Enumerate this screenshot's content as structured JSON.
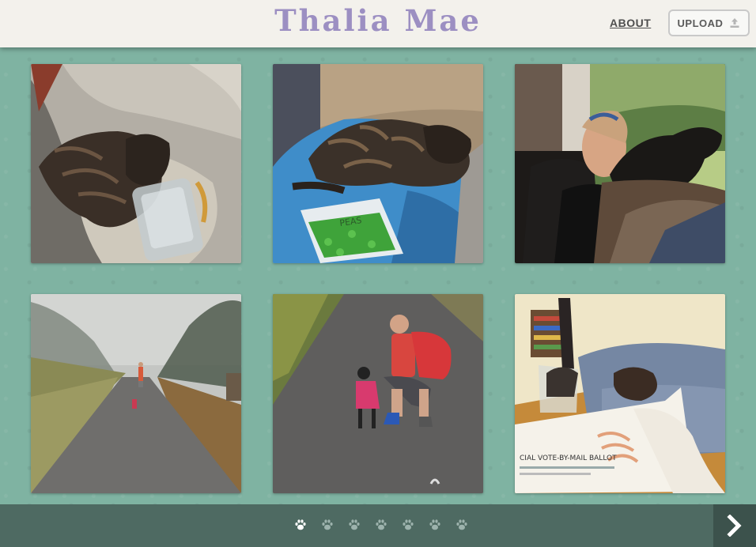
{
  "header": {
    "title": "Thalia Mae",
    "about_label": "ABOUT",
    "upload_label": "UPLOAD",
    "upload_icon": "upload-icon"
  },
  "gallery": {
    "photos": [
      {
        "name": "photo-dog-in-car-seat"
      },
      {
        "name": "photo-dog-on-blanket-with-peas"
      },
      {
        "name": "photo-woman-with-dog"
      },
      {
        "name": "photo-foggy-road-walk"
      },
      {
        "name": "photo-man-with-dog-on-road"
      },
      {
        "name": "photo-dog-on-couch-with-ballot"
      }
    ],
    "ballot_text": "CIAL VOTE-BY-MAIL BALLOT",
    "peas_label": "PEAS"
  },
  "pagination": {
    "page_count": 7,
    "current_page": 1,
    "icon": "paw-icon",
    "next_icon": "chevron-right-icon"
  },
  "colors": {
    "background": "#7fb3a2",
    "header": "#f3f1ec",
    "title": "#9c8fc2",
    "footer": "#4e6a62",
    "next_button": "#3c524c",
    "paw_active": "#ffffff",
    "paw_inactive": "#9db3ad"
  }
}
